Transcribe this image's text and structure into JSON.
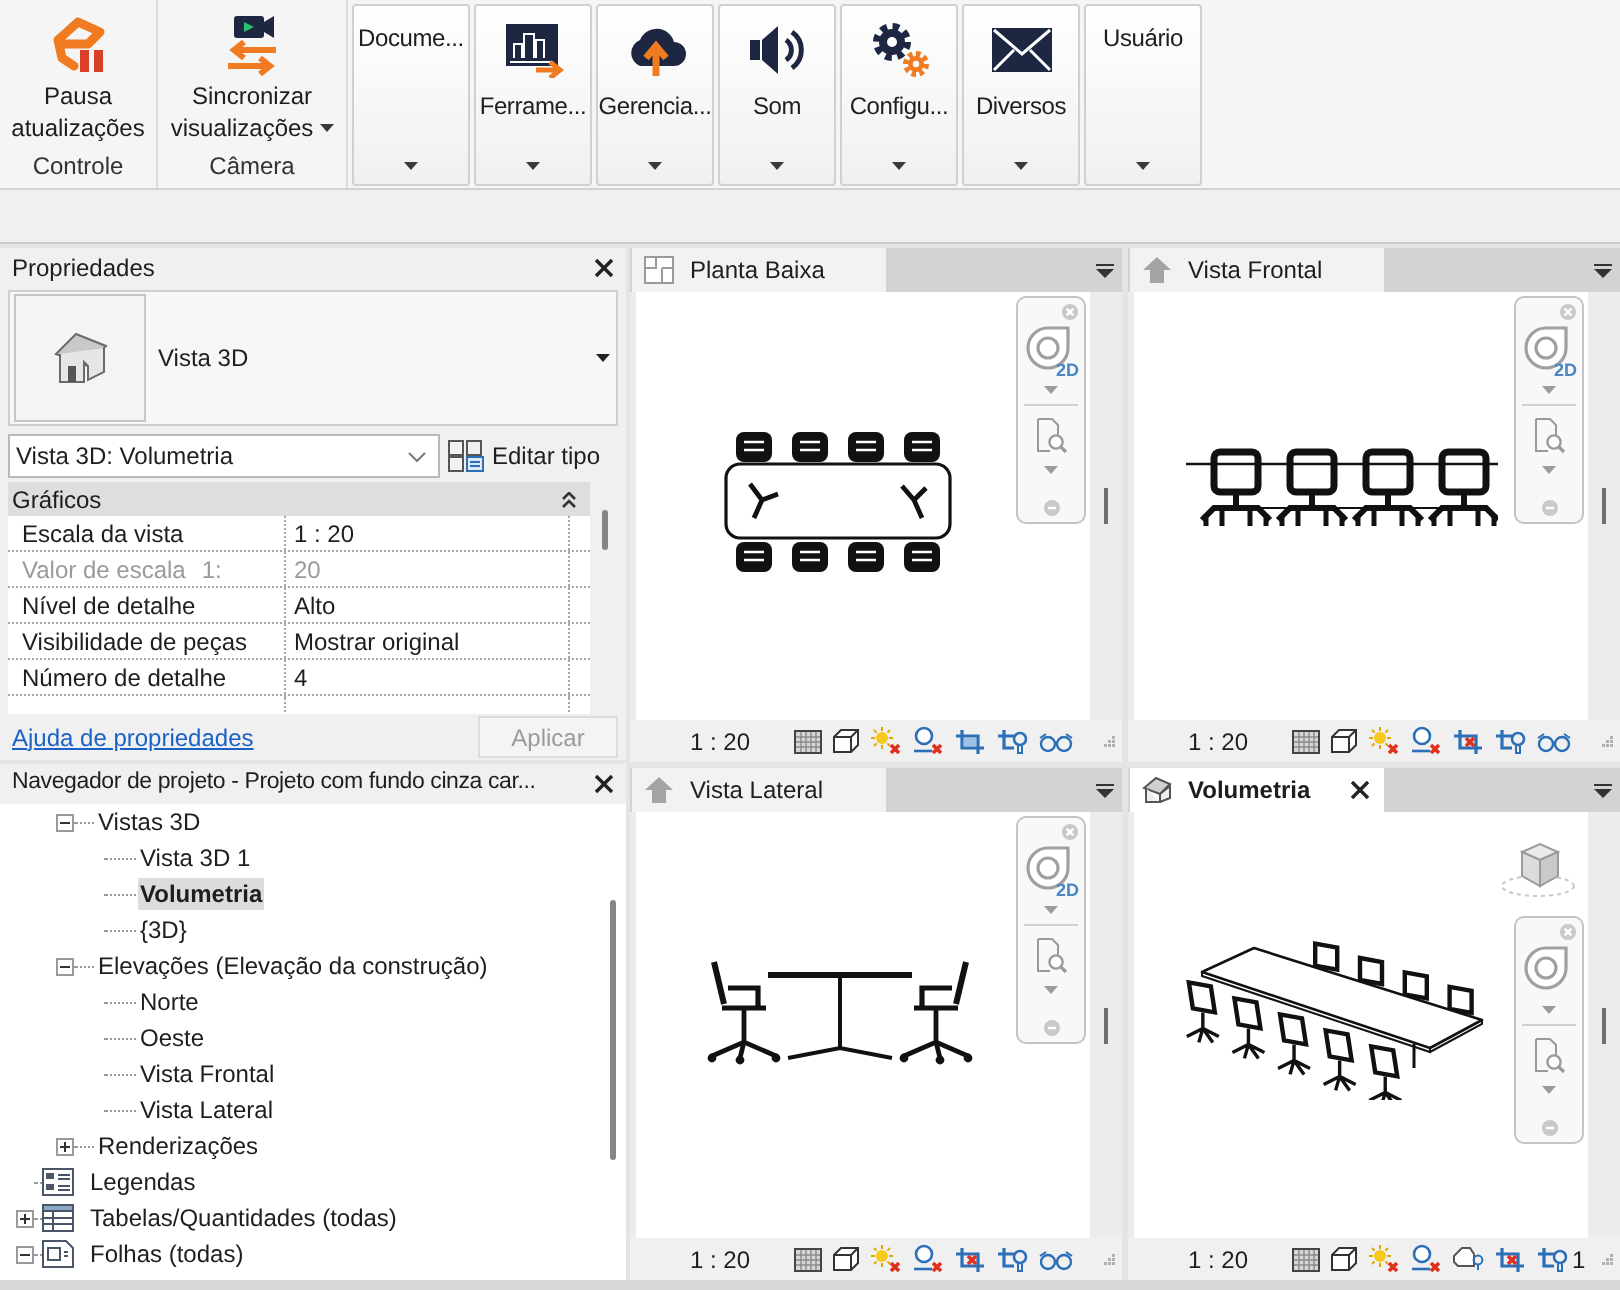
{
  "ribbon": {
    "panels": [
      {
        "label": "Controle",
        "buttons": [
          {
            "label": "Pausa atualizações",
            "kind": "pause",
            "dropdown": false
          }
        ]
      },
      {
        "label": "Câmera",
        "buttons": [
          {
            "label": "Sincronizar visualizações",
            "kind": "sync",
            "dropdown": true
          }
        ]
      }
    ],
    "menus": [
      {
        "label": "Docume...",
        "kind": "plain"
      },
      {
        "label": "Ferrame...",
        "kind": "tools"
      },
      {
        "label": "Gerencia...",
        "kind": "cloud"
      },
      {
        "label": "Som",
        "kind": "sound"
      },
      {
        "label": "Configu...",
        "kind": "settings"
      },
      {
        "label": "Diversos",
        "kind": "mail"
      },
      {
        "label": "Usuário",
        "kind": "plain"
      }
    ]
  },
  "properties": {
    "title": "Propriedades",
    "type_selector": "Vista 3D",
    "instance": "Vista 3D: Volumetria",
    "edit_type": "Editar tipo",
    "groups": [
      {
        "label": "Gráficos",
        "expanded": true,
        "rows": [
          {
            "name": "Escala da vista",
            "value": "1 : 20",
            "disabled": false
          },
          {
            "name": "Valor de escala",
            "suffix": "1:",
            "value": "20",
            "disabled": true
          },
          {
            "name": "Nível de detalhe",
            "value": "Alto",
            "disabled": false
          },
          {
            "name": "Visibilidade de peças",
            "value": "Mostrar original",
            "disabled": false
          },
          {
            "name": "Número de detalhe",
            "value": "4",
            "disabled": false
          }
        ]
      }
    ],
    "help_link": "Ajuda de propriedades",
    "apply": {
      "label": "Aplicar",
      "disabled": true
    }
  },
  "project_browser": {
    "title": "Navegador de projeto - Projeto com fundo cinza car...",
    "tree": [
      {
        "children": [
          {
            "label": "Vistas 3D",
            "kind": "group",
            "expanded": true,
            "selected": false,
            "children": [
              {
                "label": "Vista 3D 1",
                "kind": "view",
                "selected": false
              },
              {
                "label": "Volumetria",
                "kind": "view",
                "selected": true
              },
              {
                "label": "{3D}",
                "kind": "view",
                "selected": false
              }
            ]
          },
          {
            "label": "Elevações (Elevação da construção)",
            "kind": "group",
            "expanded": true,
            "selected": false,
            "children": [
              {
                "label": "Norte",
                "kind": "view",
                "selected": false
              },
              {
                "label": "Oeste",
                "kind": "view",
                "selected": false
              },
              {
                "label": "Vista Frontal",
                "kind": "view",
                "selected": false
              },
              {
                "label": "Vista Lateral",
                "kind": "view",
                "selected": false
              }
            ]
          },
          {
            "label": "Renderizações",
            "kind": "group",
            "expanded": false,
            "selected": false
          }
        ]
      },
      {
        "label": "Legendas",
        "kind": "legends",
        "selected": false
      },
      {
        "label": "Tabelas/Quantidades (todas)",
        "kind": "schedules",
        "expanded": false,
        "selected": false
      },
      {
        "label": "Folhas (todas)",
        "kind": "sheets",
        "expanded": true,
        "selected": false
      }
    ]
  },
  "views": [
    {
      "title": "Planta Baixa",
      "kind": "plan",
      "selected": false,
      "wheel_label": "2D",
      "scale": "1 : 20"
    },
    {
      "title": "Vista Frontal",
      "kind": "front",
      "selected": false,
      "wheel_label": "2D",
      "scale": "1 : 20"
    },
    {
      "title": "Vista Lateral",
      "kind": "side",
      "selected": false,
      "wheel_label": "2D",
      "scale": "1 : 20"
    },
    {
      "title": "Volumetria",
      "kind": "isometric",
      "selected": true,
      "scale": "1 : 20",
      "cut_text": "1"
    }
  ]
}
